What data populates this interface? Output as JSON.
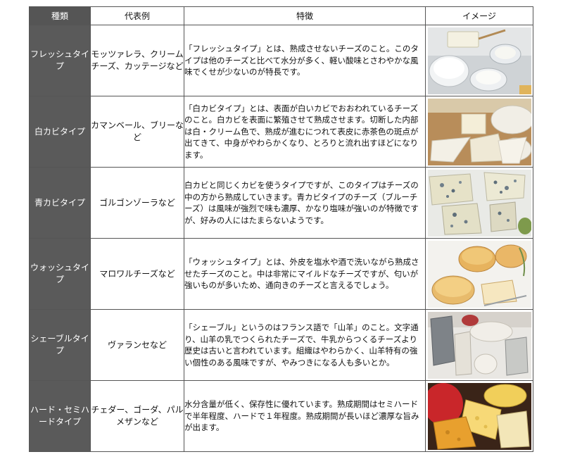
{
  "headers": [
    "種類",
    "代表例",
    "特徴",
    "イメージ"
  ],
  "rows": [
    {
      "type": "フレッシュタイプ",
      "example": "モッツァレラ、クリームチーズ、カッテージなど",
      "feature": "「フレッシュタイプ」とは、熟成させないチーズのこと。このタイプは他のチーズと比べて水分が多く、軽い酸味とさわやかな風味でくせが少ないのが特長です。",
      "image": "fresh-cheese-photo"
    },
    {
      "type": "白カビタイプ",
      "example": "カマンベール、ブリーなど",
      "feature": "「白カビタイプ」とは、表面が白いカビでおおわれているチーズのこと。白カビを表面に繁殖させて熟成させます。切断した内部は白・クリーム色で、熟成が進むにつれて表皮に赤茶色の斑点が出てきて、中身がやわらかくなり、とろりと流れ出すほどになります。",
      "image": "white-mold-cheese-photo"
    },
    {
      "type": "青カビタイプ",
      "example": "ゴルゴンゾーラなど",
      "feature": "白カビと同じくカビを使うタイプですが、このタイプはチーズの中の方から熟成していきます。青カビタイプのチーズ（ブルーチーズ）は風味が強烈で味も濃厚、かなり塩味が強いのが特徴ですが、好みの人にはたまらないようです。",
      "image": "blue-cheese-photo"
    },
    {
      "type": "ウォッシュタイプ",
      "example": "マロワルチーズなど",
      "feature": "「ウォッシュタイプ」とは、外皮を塩水や酒で洗いながら熟成させたチーズのこと。中は非常にマイルドなチーズですが、匂いが強いものが多いため、通向きのチーズと言えるでしょう。",
      "image": "washed-rind-cheese-photo"
    },
    {
      "type": "シェーブルタイプ",
      "example": "ヴァランセなど",
      "feature": "「シェーブル」というのはフランス語で「山羊」のこと。文字通り、山羊の乳でつくられたチーズで、牛乳からつくるチーズより歴史は古いと言われています。組織はやわらかく、山羊特有の強い個性のある風味ですが、やみつきになる人も多いとか。",
      "image": "goat-cheese-photo"
    },
    {
      "type": "ハード・セミハードタイプ",
      "example": "チェダー、ゴーダ、パルメザンなど",
      "feature": "水分含量が低く、保存性に優れています。熟成期間はセミハードで半年程度、ハードで１年程度。熟成期間が長いほど濃厚な旨みが出ます。",
      "image": "hard-cheese-photo"
    }
  ]
}
